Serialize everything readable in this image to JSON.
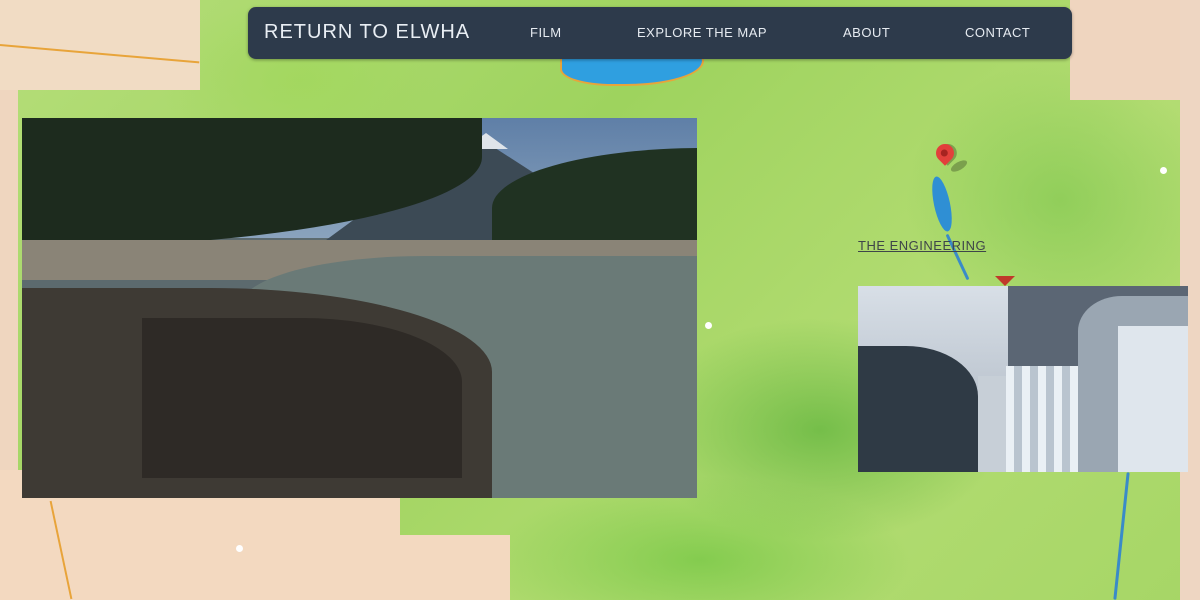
{
  "header": {
    "brand": "RETURN TO ELWHA",
    "nav": [
      {
        "label": "FILM"
      },
      {
        "label": "EXPLORE THE MAP"
      },
      {
        "label": "ABOUT"
      },
      {
        "label": "CONTACT"
      }
    ]
  },
  "map": {
    "feature_link": "THE ENGINEERING"
  },
  "colors": {
    "nav_bg": "#2d3a4b",
    "map_green": "#a9d86a",
    "map_land": "#f3d9c0",
    "water": "#2f9fe0",
    "pin": "#e2403b"
  },
  "icons": {
    "map_pin": "map-marker-icon",
    "second_marker": "map-marker-icon"
  }
}
